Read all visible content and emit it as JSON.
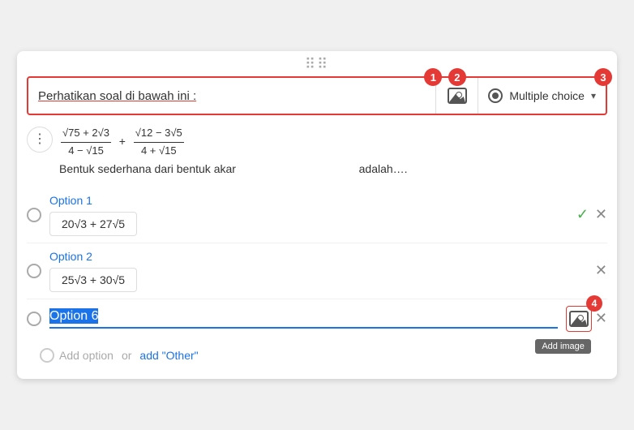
{
  "drag_handle": "⠿",
  "toolbar": {
    "question_text": "Perhatikan soal di bawah ini :",
    "badge_1": "1",
    "badge_2": "2",
    "badge_3": "3",
    "badge_4": "4",
    "type_label": "Multiple choice",
    "image_tooltip": "Add image"
  },
  "question": {
    "text_prefix": "Bentuk sederhana dari bentuk akar",
    "text_suffix": "adalah….",
    "fraction1_num": "√75 + 2√3",
    "fraction1_den": "4 − √15",
    "fraction2_num": "√12 − 3√5",
    "fraction2_den": "4 + √15"
  },
  "options": [
    {
      "id": "option1",
      "label": "Option 1",
      "math": "20√3 + 27√5",
      "has_check": true,
      "has_close": true
    },
    {
      "id": "option2",
      "label": "Option 2",
      "math": "25√3 + 30√5",
      "has_check": false,
      "has_close": true
    }
  ],
  "option6": {
    "label": "Option 6",
    "has_image_btn": true,
    "has_close": true,
    "image_btn_tooltip": "Add image"
  },
  "add_option": {
    "text": "Add option",
    "separator": "or",
    "other_text": "add \"Other\""
  },
  "icons": {
    "more_dots": "⋮",
    "check": "✓",
    "close": "✕",
    "chevron": "▾"
  }
}
